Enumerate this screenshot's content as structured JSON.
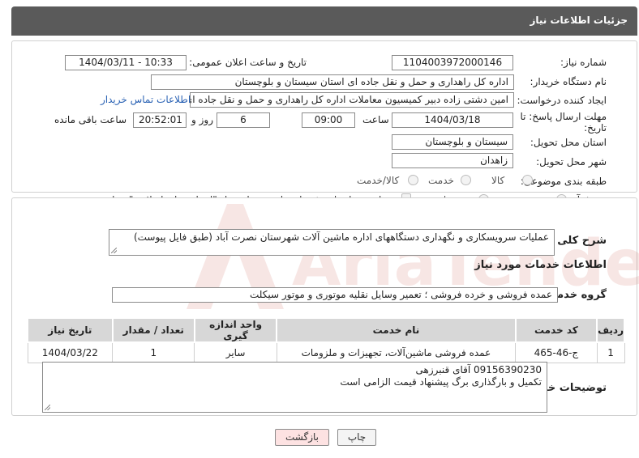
{
  "header": {
    "title": "جزئیات اطلاعات نیاز"
  },
  "form": {
    "need_number_label": "شماره نیاز:",
    "need_number": "1104003972000146",
    "announce_label": "تاریخ و ساعت اعلان عمومی:",
    "announce_value": "1404/03/11 - 10:33",
    "buyer_label": "نام دستگاه خریدار:",
    "buyer_value": "اداره کل راهداری و حمل و نقل جاده ای استان سیستان و بلوچستان",
    "creator_label": "ایجاد کننده درخواست:",
    "creator_value": "امین دشتی زاده دبیر کمیسیون معاملات اداره کل راهداری و حمل و نقل جاده ای",
    "contact_link": "اطلاعات تماس خریدار",
    "deadline_label_1": "مهلت ارسال پاسخ: تا",
    "deadline_label_2": "تاریخ:",
    "deadline_date": "1404/03/18",
    "time_label": "ساعت",
    "deadline_time": "09:00",
    "days_value": "6",
    "days_label": "روز و",
    "remaining_time": "20:52:01",
    "remaining_label": "ساعت باقی مانده",
    "province_label": "استان محل تحویل:",
    "province_value": "سیستان و بلوچستان",
    "city_label": "شهر محل تحویل:",
    "city_value": "زاهدان",
    "category_label": "طبقه بندی موضوعی:",
    "category_options": [
      "کالا",
      "خدمت",
      "کالا/خدمت"
    ],
    "process_label": "نوع فرآیند خرید :",
    "process_options": [
      "جزیی",
      "متوسط"
    ],
    "payment_note": "پرداخت تمام یا بخشی از مبلغ خرید،از محل \"اسناد خزانه اسلامی\" خواهد بود."
  },
  "details": {
    "summary_label": "شرح کلی نیاز:",
    "summary_value": "عملیات سرویسکاری و نگهداری دستگاههای اداره ماشین آلات شهرستان نصرت آباد (طبق فایل پیوست)",
    "services_heading": "اطلاعات خدمات مورد نیاز",
    "service_group_label": "گروه خدمت:",
    "service_group_value": "عمده فروشی و خرده فروشی ؛ تعمیر وسایل نقلیه موتوری و موتور سیکلت",
    "table": {
      "headers": [
        "ردیف",
        "کد خدمت",
        "نام خدمت",
        "واحد اندازه گیری",
        "تعداد / مقدار",
        "تاریخ نیاز"
      ],
      "rows": [
        [
          "1",
          "ج-46-465",
          "عمده فروشی ماشین‌آلات، تجهیزات و ملزومات",
          "سایر",
          "1",
          "1404/03/22"
        ]
      ]
    },
    "buyer_notes_label": "توضیحات خریدار:",
    "buyer_notes_line1": "09156390230 آقای قنبرزهی",
    "buyer_notes_line2": "تکمیل و بارگذاری برگ پیشنهاد قیمت الزامی است"
  },
  "buttons": {
    "print": "چاپ",
    "back": "بازگشت"
  },
  "watermark_text": "AriaTender.neT",
  "colors": {
    "header_bg": "#5a5a5a",
    "link": "#2a62b4",
    "back_btn_bg": "#fde2e2",
    "watermark": "#c0392b"
  }
}
